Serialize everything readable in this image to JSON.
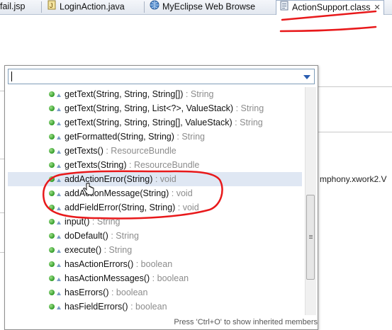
{
  "tabs": [
    {
      "label": "fail.jsp",
      "icon": "jsp-file-icon"
    },
    {
      "label": "LoginAction.java",
      "icon": "java-file-icon"
    },
    {
      "label": "MyEclipse Web Browse",
      "icon": "globe-icon"
    },
    {
      "label": "ActionSupport.class",
      "icon": "class-file-icon",
      "active": true,
      "close": "✕"
    }
  ],
  "editor": {
    "right_fragment": "mphony.xwork2.V"
  },
  "popup": {
    "filter_value": "",
    "items": [
      {
        "name": "getText(String, String, String[])",
        "ret": " : String"
      },
      {
        "name": "getText(String, String, List<?>, ValueStack)",
        "ret": " : String"
      },
      {
        "name": "getText(String, String, String[], ValueStack)",
        "ret": " : String"
      },
      {
        "name": "getFormatted(String, String)",
        "ret": " : String"
      },
      {
        "name": "getTexts()",
        "ret": " : ResourceBundle"
      },
      {
        "name": "getTexts(String)",
        "ret": " : ResourceBundle"
      },
      {
        "name": "addActionError(String)",
        "ret": " : void",
        "selected": true
      },
      {
        "name": "addActionMessage(String)",
        "ret": " : void"
      },
      {
        "name": "addFieldError(String, String)",
        "ret": " : void"
      },
      {
        "name": "input()",
        "ret": " : String"
      },
      {
        "name": "doDefault()",
        "ret": " : String"
      },
      {
        "name": "execute()",
        "ret": " : String"
      },
      {
        "name": "hasActionErrors()",
        "ret": " : boolean"
      },
      {
        "name": "hasActionMessages()",
        "ret": " : boolean"
      },
      {
        "name": "hasErrors()",
        "ret": " : boolean"
      },
      {
        "name": "hasFieldErrors()",
        "ret": " : boolean"
      }
    ],
    "status": "Press 'Ctrl+O' to show inherited members"
  },
  "colors": {
    "annotation": "#e8191b",
    "method_dot": "#2f9a27",
    "return_type": "#8c8c8c",
    "selection": "#dfe7f3"
  }
}
